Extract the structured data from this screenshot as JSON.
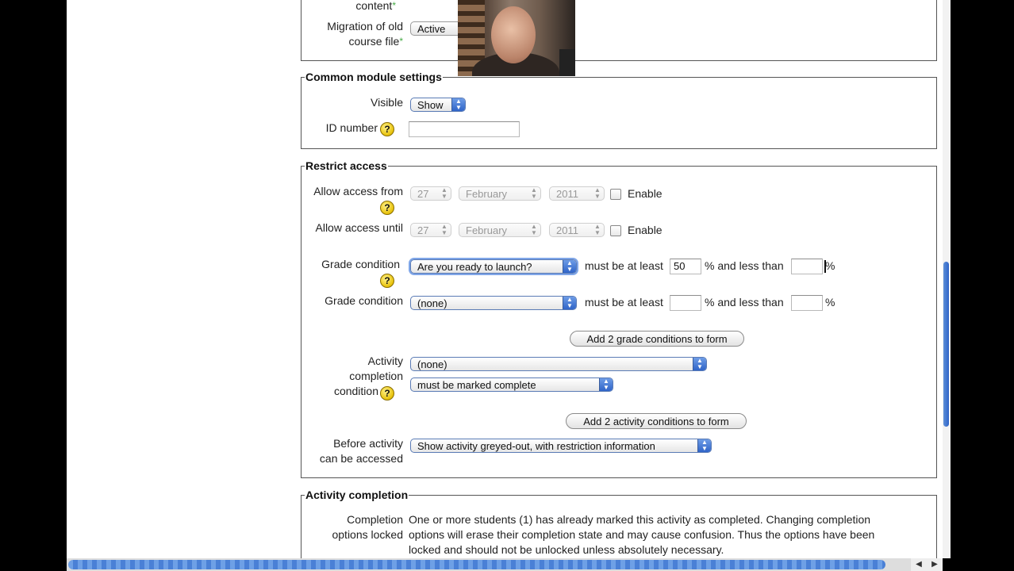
{
  "general": {
    "content_label": "content",
    "migration_label_line1": "Migration of old",
    "migration_label_line2": "course file",
    "migration_value": "Active"
  },
  "common_module": {
    "legend": "Common module settings",
    "visible_label": "Visible",
    "visible_value": "Show",
    "id_number_label": "ID number",
    "id_number_value": ""
  },
  "restrict_access": {
    "legend": "Restrict access",
    "allow_from_label": "Allow access from",
    "allow_until_label": "Allow access until",
    "day": "27",
    "month": "February",
    "year": "2011",
    "enable_label": "Enable",
    "grade_condition_label": "Grade condition",
    "grade1_select": "Are you ready to launch?",
    "grade2_select": "(none)",
    "must_be_at_least": "must be at least",
    "grade1_min": "50",
    "grade2_min": "",
    "and_less_than": "% and less than",
    "percent": "%",
    "add_grade_button": "Add 2 grade conditions to form",
    "activity_label_line1": "Activity",
    "activity_label_line2": "completion",
    "activity_label_line3": "condition",
    "activity_select": "(none)",
    "activity_state": "must be marked complete",
    "add_activity_button": "Add 2 activity conditions to form",
    "before_label_line1": "Before activity",
    "before_label_line2": "can be accessed",
    "before_select": "Show activity greyed-out, with restriction information"
  },
  "activity_completion": {
    "legend": "Activity completion",
    "locked_label_line1": "Completion",
    "locked_label_line2": "options locked",
    "locked_text_line1": "One or more students (1) has already marked this activity as completed. Changing completion",
    "locked_text_line2": "options will erase their completion state and may cause confusion. Thus the options have been",
    "locked_text_line3": "locked and should not be unlocked unless absolutely necessary."
  },
  "help_glyph": "?",
  "icons": [
    "help-icon",
    "select-arrow-icon",
    "checkbox-icon",
    "scroll-left-icon",
    "scroll-right-icon"
  ],
  "colors": {
    "accent": "#2f64c8",
    "help": "#e8c20a",
    "required": "#44aa44"
  }
}
